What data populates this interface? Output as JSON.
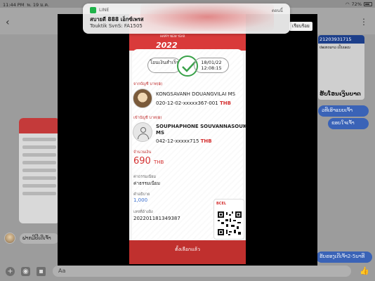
{
  "statusbar": {
    "time": "11:44 PM",
    "date": "พ. 19 ม.ค.",
    "wifi": "WiFi",
    "battery": "72%",
    "battery_level": 0.72
  },
  "notification": {
    "app": "LINE",
    "time": "ตอนนี้",
    "title": "สบายดี 888 เอ็กซ์เพรส",
    "body": "Touktik SvnS: FA1505"
  },
  "viewer": {
    "done_button": "เรียบร้อย"
  },
  "chat": {
    "right_card_number": "21203931715",
    "right_card_text_1": "ປະເທດລາວ ເປັນເອເນ",
    "right_card_text_2": "ຮັບໂອນເງິນບາດ",
    "right_bubble_1": "ວທີເອົາແບບເຈົ້າ",
    "right_bubble_2": "ຂອບໃຈເຈົ້າ",
    "right_bubble_3": "ຮັບຮອງເດີເຈົ້າ2-5ນາທີ",
    "left_bubble": "ຟາກມີປີເດີເຈົ້າ",
    "composer_placeholder": "Aa"
  },
  "receipt": {
    "banner_year": "2022",
    "banner_sub": "HAPPY NEW YEAR",
    "status": "โอนเงินสำเร็จ",
    "date": "18/01/22",
    "time": "12:08:15",
    "from_label": "จากบัญชี บาท(฿)",
    "from_name": "KONGSAVANH DOUANGVILAI MS",
    "from_account": "020-12-02-xxxxx367-001",
    "to_label": "เข้าบัญชี บาท(฿)",
    "to_name_1": "SOUPHAPHONE SOUVANNASOUK",
    "to_name_2": "MS",
    "to_account": "042-12-xxxxx715",
    "currency": "THB",
    "amount_label": "จำนวนเงิน",
    "amount": "690",
    "fee_label": "ค่าธรรมเนียม",
    "fee": "ค่าธรรมเนียม",
    "balance_label": "คำอธิบาย",
    "balance": "1,000",
    "ref_label": "เลขที่อ้างอิง",
    "ref": "202201181349387",
    "qr_logo": "BCEL",
    "bottom_button": "ตั้งเลือกแล้ว"
  }
}
